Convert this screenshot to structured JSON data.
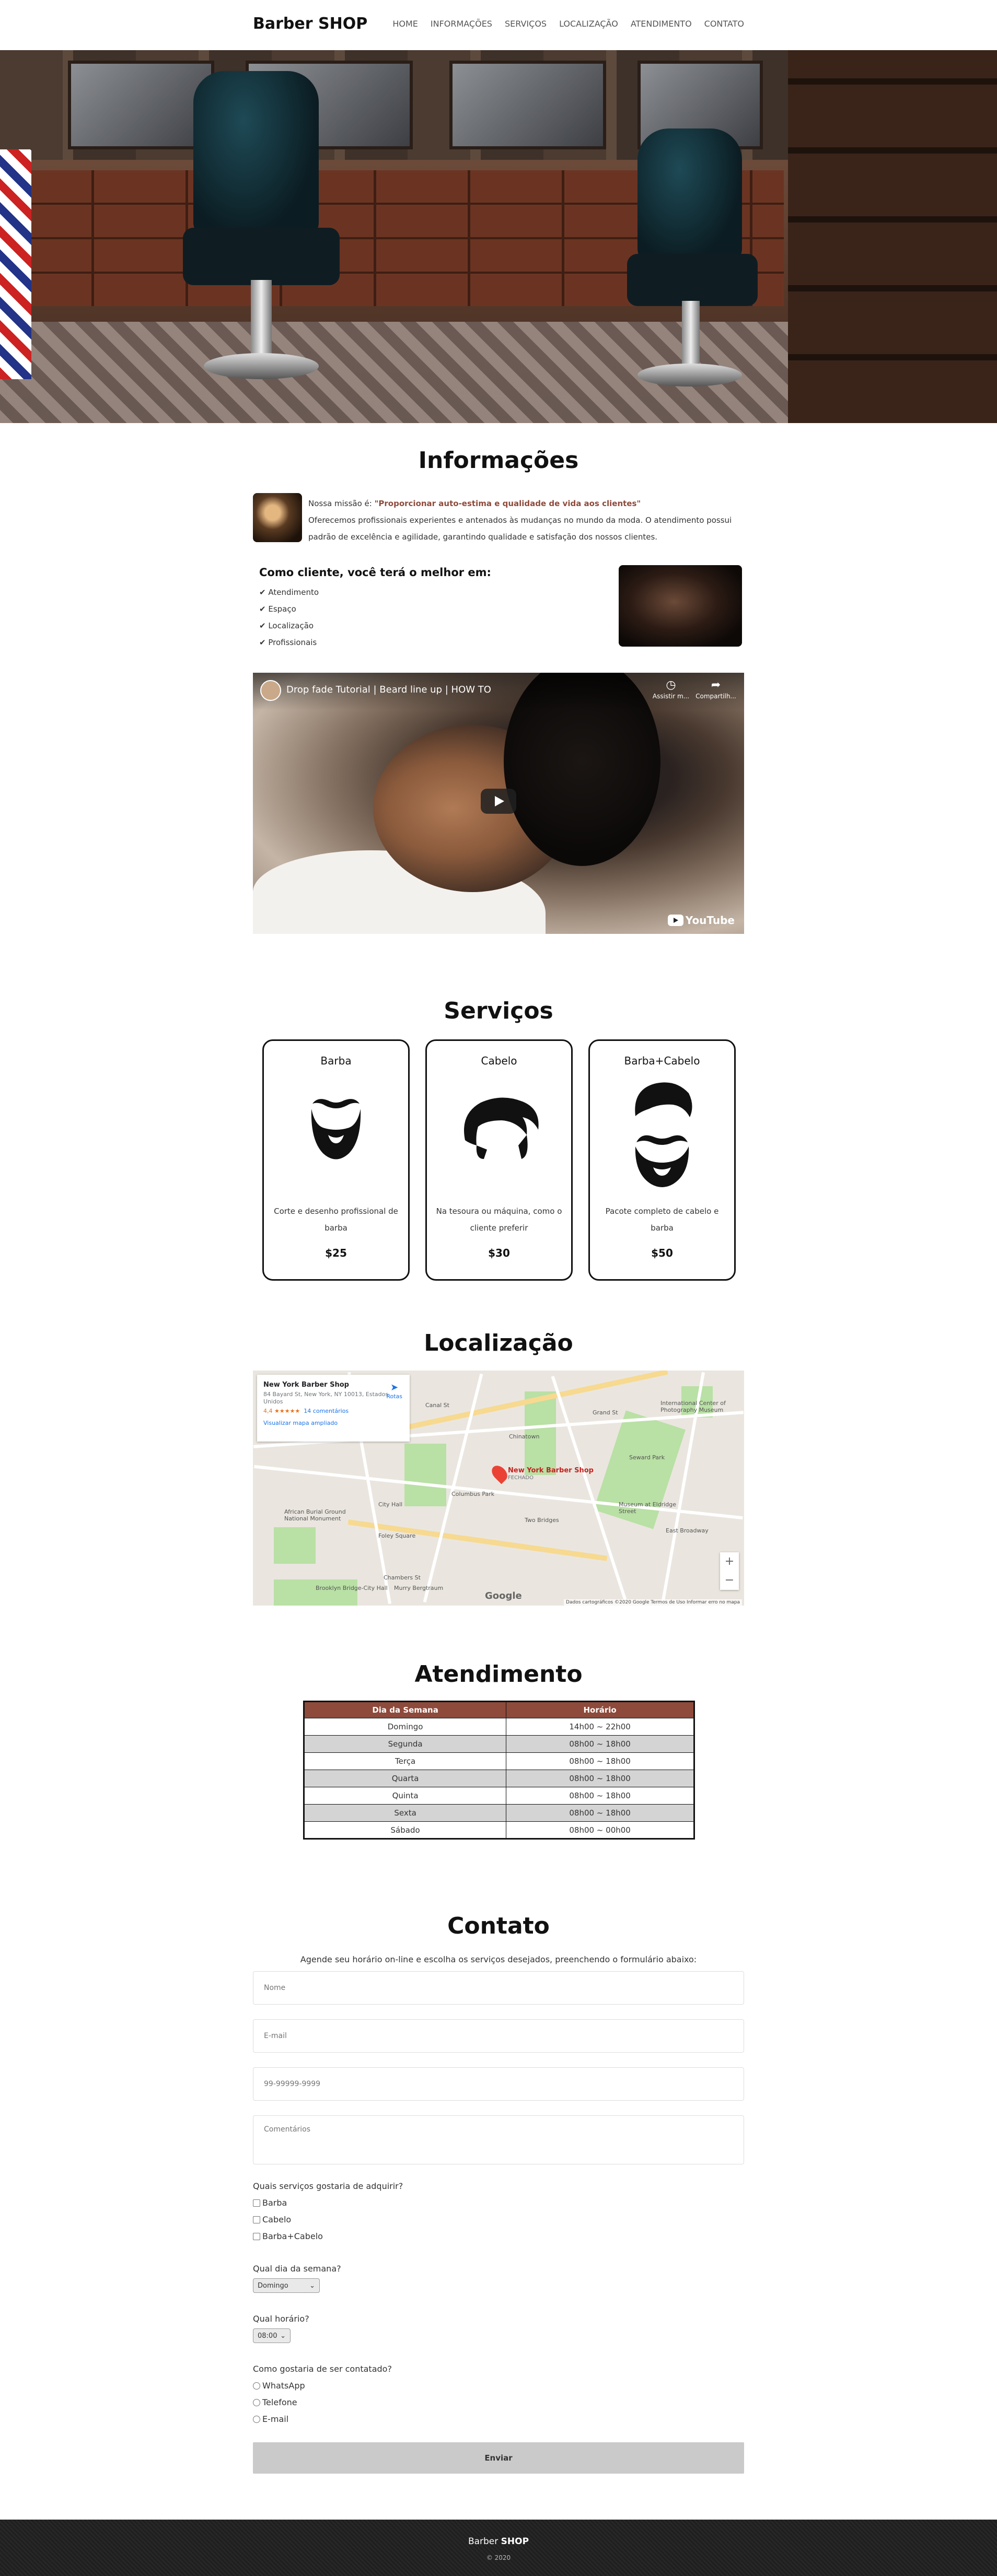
{
  "nav": {
    "brand_prefix": "Barber",
    "brand_suffix": "SHOP",
    "items": [
      "HOME",
      "INFORMAÇÕES",
      "SERVIÇOS",
      "LOCALIZAÇÃO",
      "ATENDIMENTO",
      "CONTATO"
    ]
  },
  "info": {
    "title": "Informações",
    "mission_label": "Nossa missão é: ",
    "mission_quote": "\"Proporcionar auto-estima e qualidade de vida aos clientes\"",
    "description": "Oferecemos profissionais experientes e antenados às mudanças no mundo da moda. O atendimento possui padrão de excelência e agilidade, garantindo qualidade e satisfação dos nossos clientes.",
    "benefits_title": "Como cliente, você terá o melhor em:",
    "benefits": [
      "✔ Atendimento",
      "✔ Espaço",
      "✔ Localização",
      "✔ Profissionais"
    ]
  },
  "video": {
    "title": "Drop fade Tutorial | Beard line up | HOW TO",
    "watch_later": "Assistir m...",
    "share": "Compartilh...",
    "brand": "YouTube"
  },
  "services": {
    "title": "Serviços",
    "cards": [
      {
        "name": "Barba",
        "description": "Corte e desenho profissional de barba",
        "price": "$25",
        "icon": "beard-icon"
      },
      {
        "name": "Cabelo",
        "description": "Na tesoura ou máquina, como o cliente preferir",
        "price": "$30",
        "icon": "hair-icon"
      },
      {
        "name": "Barba+Cabelo",
        "description": "Pacote completo de cabelo e barba",
        "price": "$50",
        "icon": "hair-beard-icon"
      }
    ]
  },
  "location": {
    "title": "Localização",
    "place_name": "New York Barber Shop",
    "address": "84 Bayard St, New York, NY 10013, Estados Unidos",
    "rating": "4,4 ★★★★★",
    "reviews": "14 comentários",
    "larger_map": "Visualizar mapa ampliado",
    "route": "Rotas",
    "pin_label": "New York Barber Shop",
    "pin_sub": "FECHADO",
    "map_labels": [
      "Canal St",
      "Grand St",
      "International Center of Photography Museum",
      "Chinatown",
      "Columbus Park",
      "City Hall",
      "Foley Square",
      "Chambers St",
      "African Burial Ground National Monument",
      "Two Bridges",
      "East Broadway",
      "Murry Bergtraum",
      "Brooklyn Bridge-City Hall",
      "Museum at Eldridge Street",
      "Seward Park"
    ],
    "zoom_in": "+",
    "zoom_out": "−",
    "google": "Google",
    "footer": "Dados cartográficos ©2020 Google   Termos de Uso   Informar erro no mapa"
  },
  "hours": {
    "title": "Atendimento",
    "headers": [
      "Dia da Semana",
      "Horário"
    ],
    "rows": [
      [
        "Domingo",
        "14h00 ~ 22h00"
      ],
      [
        "Segunda",
        "08h00 ~ 18h00"
      ],
      [
        "Terça",
        "08h00 ~ 18h00"
      ],
      [
        "Quarta",
        "08h00 ~ 18h00"
      ],
      [
        "Quinta",
        "08h00 ~ 18h00"
      ],
      [
        "Sexta",
        "08h00 ~ 18h00"
      ],
      [
        "Sábado",
        "08h00 ~ 00h00"
      ]
    ]
  },
  "contact": {
    "title": "Contato",
    "lead": "Agende seu horário on-line e escolha os serviços desejados, preenchendo o formulário abaixo:",
    "name_placeholder": "Nome",
    "email_placeholder": "E-mail",
    "phone_placeholder": "99-99999-9999",
    "comments_placeholder": "Comentários",
    "services_question": "Quais serviços gostaria de adquirir?",
    "services_options": [
      "Barba",
      "Cabelo",
      "Barba+Cabelo"
    ],
    "day_question": "Qual dia da semana?",
    "day_selected": "Domingo",
    "time_question": "Qual horário?",
    "time_selected": "08:00",
    "contact_question": "Como gostaria de ser contatado?",
    "contact_options": [
      "WhatsApp",
      "Telefone",
      "E-mail"
    ],
    "submit": "Enviar"
  },
  "footer": {
    "brand_prefix": "Barber",
    "brand_suffix": "SHOP",
    "copyright": "© 2020"
  },
  "colors": {
    "accent": "#8e4a3b",
    "footer_bg": "#232323",
    "table_stripe": "#d4d4d4"
  }
}
